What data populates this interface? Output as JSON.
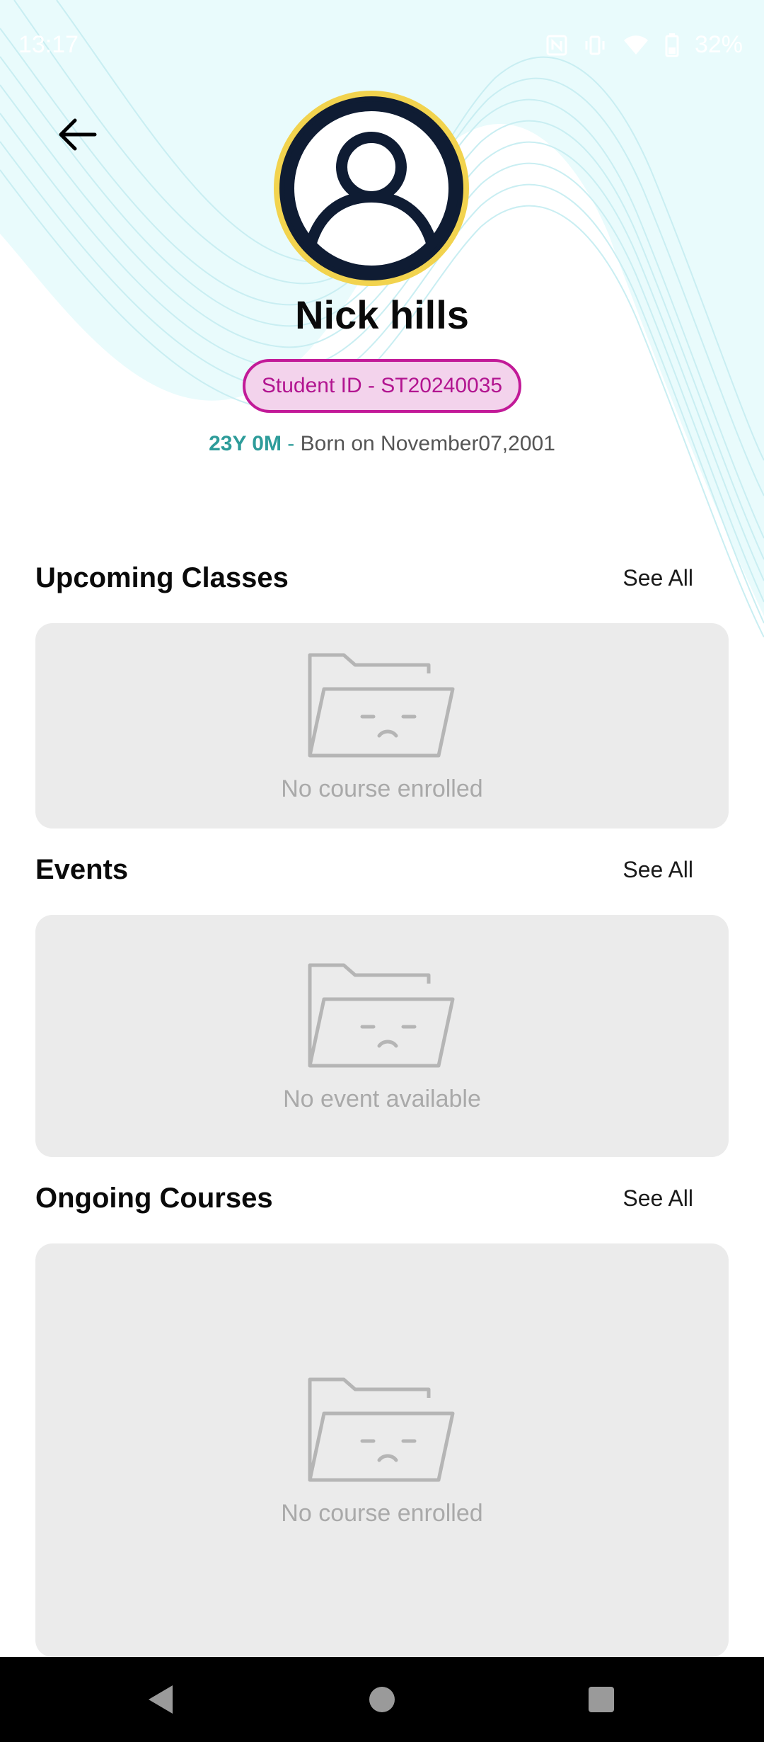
{
  "status_bar": {
    "time": "13:17",
    "battery": "32%",
    "icons": [
      "nfc-icon",
      "vibrate-icon",
      "wifi-icon",
      "battery-icon"
    ]
  },
  "profile": {
    "name": "Nick hills",
    "student_id": "Student ID - ST20240035",
    "age": "23Y 0M",
    "separator": " - ",
    "born": "Born on November07,2001"
  },
  "sections": {
    "upcoming": {
      "title": "Upcoming Classes",
      "see_all": "See All",
      "empty": "No course enrolled"
    },
    "events": {
      "title": "Events",
      "see_all": "See All",
      "empty": "No event available"
    },
    "ongoing": {
      "title": "Ongoing Courses",
      "see_all": "See All",
      "empty": "No course enrolled"
    }
  },
  "colors": {
    "accent_magenta": "#c21a98",
    "badge_bg": "#f3d3ec",
    "age_teal": "#2e9c9a",
    "avatar_ring": "#f2d34e",
    "card_bg": "#ebebeb"
  }
}
